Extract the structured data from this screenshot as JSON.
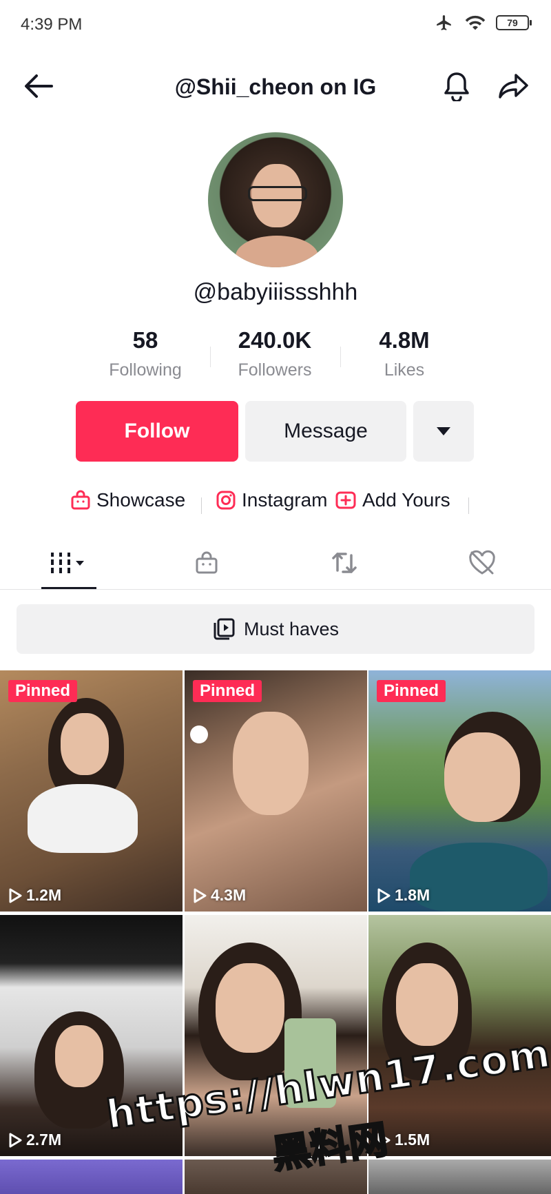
{
  "status_bar": {
    "time": "4:39 PM",
    "battery": "79"
  },
  "header": {
    "title": "@Shii_cheon on IG"
  },
  "profile": {
    "username": "@babyiiissshhh",
    "stats": [
      {
        "value": "58",
        "label": "Following"
      },
      {
        "value": "240.0K",
        "label": "Followers"
      },
      {
        "value": "4.8M",
        "label": "Likes"
      }
    ]
  },
  "actions": {
    "follow_label": "Follow",
    "message_label": "Message"
  },
  "links": [
    {
      "label": "Showcase",
      "icon": "bag-icon"
    },
    {
      "label": "Instagram",
      "icon": "instagram-icon"
    },
    {
      "label": "Add Yours",
      "icon": "add-yours-icon"
    }
  ],
  "tabs": [
    {
      "name": "videos",
      "icon": "grid-icon"
    },
    {
      "name": "shop",
      "icon": "bag-icon"
    },
    {
      "name": "reposts",
      "icon": "repost-icon"
    },
    {
      "name": "liked",
      "icon": "liked-hidden-icon"
    }
  ],
  "collection": {
    "label": "Must haves"
  },
  "videos": [
    {
      "views": "1.2M",
      "pinned": "Pinned"
    },
    {
      "views": "4.3M",
      "pinned": "Pinned"
    },
    {
      "views": "1.8M",
      "pinned": "Pinned"
    },
    {
      "views": "2.7M",
      "pinned": ""
    },
    {
      "views": "",
      "pinned": ""
    },
    {
      "views": "1.5M",
      "pinned": ""
    }
  ],
  "watermark": {
    "url": "https://hlwn17.com",
    "text": "黑料网"
  },
  "colors": {
    "accent": "#fe2c55",
    "text": "#161823",
    "muted": "#8a8b91",
    "button_bg": "#f1f1f2"
  }
}
